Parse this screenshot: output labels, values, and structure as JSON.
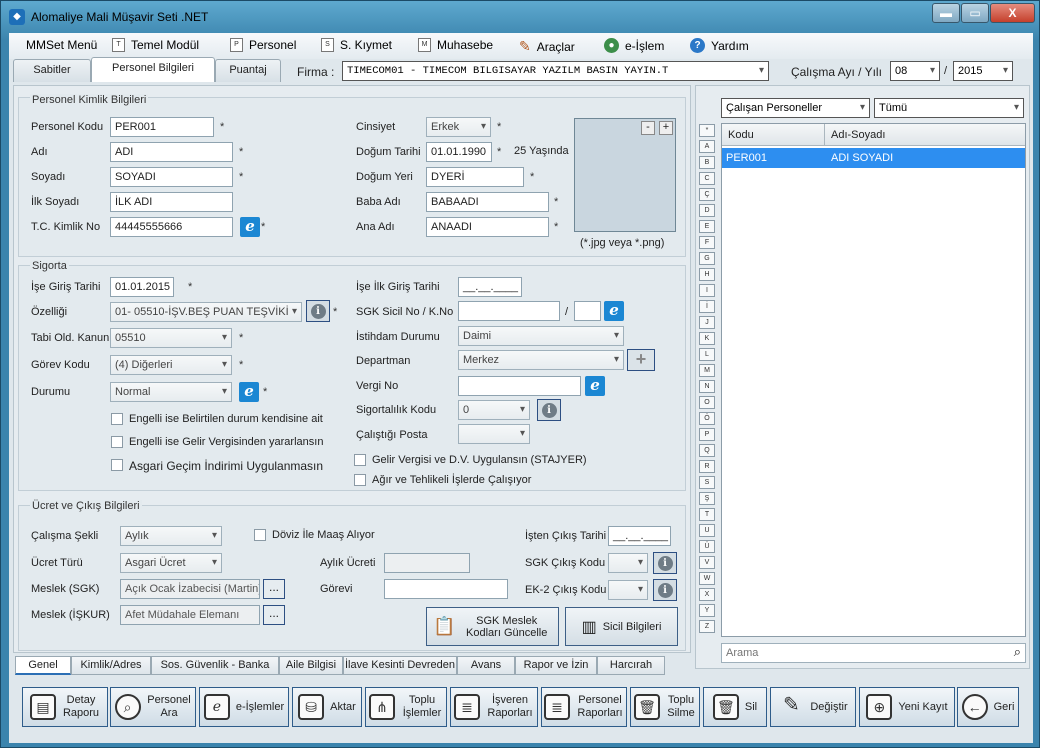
{
  "window": {
    "title": "Alomaliye Mali Müşavir Seti .NET",
    "min": "▬",
    "max": "▭",
    "close": "X"
  },
  "menu": [
    {
      "label": "MMSet Menü"
    },
    {
      "label": "Temel Modül",
      "icon": "T"
    },
    {
      "label": "Personel",
      "icon": "P"
    },
    {
      "label": "S. Kıymet",
      "icon": "S"
    },
    {
      "label": "Muhasebe",
      "icon": "M"
    },
    {
      "label": "Araçlar"
    },
    {
      "label": "e-İşlem"
    },
    {
      "label": "Yardım"
    }
  ],
  "tabs": [
    "Sabitler",
    "Personel Bilgileri",
    "Puantaj"
  ],
  "firma": {
    "label": "Firma :",
    "value": "TIMECOM01        - TIMECOM BILGISAYAR YAZILM BASIN YAYIN.T"
  },
  "period": {
    "label": "Çalışma Ayı / Yılı",
    "month": "08",
    "sep": "/",
    "year": "2015"
  },
  "kimlik": {
    "title": "Personel Kimlik Bilgileri",
    "kod_label": "Personel Kodu",
    "kod": "PER001",
    "adi_label": "Adı",
    "adi": "ADI",
    "soyadi_label": "Soyadı",
    "soyadi": "SOYADI",
    "ilk_soyadi_label": "İlk Soyadı",
    "ilk_soyadi": "İLK ADI",
    "tc_label": "T.C. Kimlik No",
    "tc": "44445555666",
    "cinsiyet_label": "Cinsiyet",
    "cinsiyet": "Erkek",
    "dogum_tarihi_label": "Doğum Tarihi",
    "dogum_tarihi": "01.01.1990",
    "yas": "25 Yaşında",
    "dogum_yeri_label": "Doğum Yeri",
    "dogum_yeri": "DYERİ",
    "baba_label": "Baba Adı",
    "baba": "BABAADI",
    "ana_label": "Ana Adı",
    "ana": "ANAADI",
    "photo_hint": "(*.jpg veya *.png)",
    "photo_minus": "-",
    "photo_plus": "+"
  },
  "star": "*",
  "sigorta": {
    "title": "Sigorta",
    "ise_giris_label": "İşe Giriş Tarihi",
    "ise_giris": "01.01.2015",
    "ozelligi_label": "Özelliği",
    "ozelligi": "01- 05510-İŞV.BEŞ PUAN TEŞVİKİ",
    "kanun_label": "Tabi Old. Kanun",
    "kanun": "05510",
    "gorev_kodu_label": "Görev Kodu",
    "gorev_kodu": "(4) Diğerleri",
    "durumu_label": "Durumu",
    "durumu": "Normal",
    "chk1": "Engelli ise Belirtilen durum kendisine ait",
    "chk2": "Engelli ise Gelir Vergisinden yararlansın",
    "chk3": "Asgari Geçim İndirimi Uygulanmasın",
    "ilk_giris_label": "İşe İlk Giriş Tarihi",
    "ilk_giris": "__.__.____",
    "sgk_sicil_label": "SGK Sicil No / K.No",
    "sgk_sep": "/",
    "istihdam_label": "İstihdam Durumu",
    "istihdam": "Daimi",
    "departman_label": "Departman",
    "departman": "Merkez",
    "vergi_label": "Vergi No",
    "sigortalilik_label": "Sigortalılık Kodu",
    "sigortalilik": "0",
    "posta_label": "Çalıştığı Posta",
    "chk4": "Gelir Vergisi ve D.V. Uygulansın (STAJYER)",
    "chk5": "Ağır ve Tehlikeli İşlerde Çalışıyor"
  },
  "ucret": {
    "title": "Ücret ve Çıkış Bilgileri",
    "sekli_label": "Çalışma Şekli",
    "sekli": "Aylık",
    "turu_label": "Ücret Türü",
    "turu": "Asgari Ücret",
    "meslek_sgk_label": "Meslek (SGK)",
    "meslek_sgk": "Açık Ocak İzabecisi (Martin)",
    "meslek_iskur_label": "Meslek (İŞKUR)",
    "meslek_iskur": "Afet Müdahale Elemanı",
    "doviz": "Döviz İle Maaş Alıyor",
    "aylik_label": "Aylık Ücreti",
    "gorevi_label": "Görevi",
    "cikis_tarih_label": "İşten Çıkış Tarihi",
    "cikis_tarih": "__.__.____",
    "sgk_cikis_label": "SGK Çıkış Kodu",
    "ek2_label": "EK-2 Çıkış Kodu",
    "btn_sgk": "SGK Meslek Kodları Güncelle",
    "btn_sicil": "Sicil Bilgileri",
    "dots": "..."
  },
  "bottom_tabs": [
    "Genel",
    "Kimlik/Adres",
    "Sos. Güvenlik - Banka",
    "Aile Bilgisi",
    "İlave Kesinti Devreden",
    "Avans",
    "Rapor ve İzin",
    "Harcırah"
  ],
  "right": {
    "filter1": "Çalışan Personeller",
    "filter2": "Tümü",
    "col_kod": "Kodu",
    "col_ad": "Adı-Soyadı",
    "rows": [
      {
        "kod": "PER001",
        "ad": "ADI SOYADI"
      }
    ],
    "search_placeholder": "Arama",
    "letters": [
      "*",
      "A",
      "B",
      "C",
      "Ç",
      "D",
      "E",
      "F",
      "G",
      "H",
      "I",
      "İ",
      "J",
      "K",
      "L",
      "M",
      "N",
      "O",
      "Ö",
      "P",
      "Q",
      "R",
      "S",
      "Ş",
      "T",
      "U",
      "Ü",
      "V",
      "W",
      "X",
      "Y",
      "Z"
    ]
  },
  "toolbar": [
    "Detay Raporu",
    "Personel Ara",
    "e-İşlemler",
    "Aktar",
    "Toplu İşlemler",
    "İşveren Raporları",
    "Personel Raporları",
    "Toplu Silme",
    "Sil",
    "Değiştir",
    "Yeni Kayıt",
    "Geri"
  ]
}
